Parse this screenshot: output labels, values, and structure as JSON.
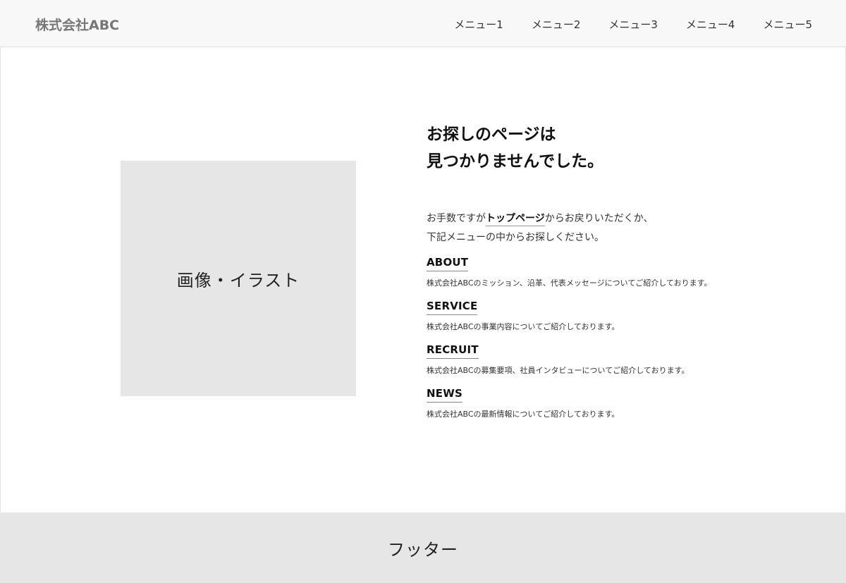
{
  "header": {
    "logo": "株式会社ABC",
    "nav": [
      "メニュー1",
      "メニュー2",
      "メニュー3",
      "メニュー4",
      "メニュー5"
    ]
  },
  "image_placeholder": "画像・イラスト",
  "main": {
    "title_line1": "お探しのページは",
    "title_line2": "見つかりませんでした。",
    "lead_prefix": "お手数ですが",
    "lead_link": "トップページ",
    "lead_suffix": "からお戻りいただくか、",
    "lead_line2": "下記メニューの中からお探しください。",
    "sections": [
      {
        "heading": "ABOUT",
        "description": "株式会社ABCのミッション、沿革、代表メッセージについてご紹介しております。"
      },
      {
        "heading": "SERVICE",
        "description": "株式会社ABCの事業内容についてご紹介しております。"
      },
      {
        "heading": "RECRUIT",
        "description": "株式会社ABCの募集要項、社員インタビューについてご紹介しております。"
      },
      {
        "heading": "NEWS",
        "description": "株式会社ABCの最新情報についてご紹介しております。"
      }
    ]
  },
  "footer": {
    "label": "フッター"
  }
}
